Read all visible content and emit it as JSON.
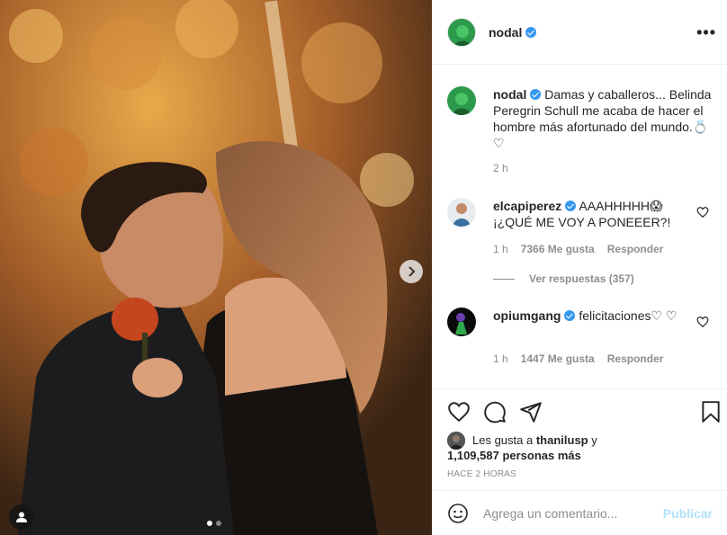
{
  "post": {
    "username": "nodal",
    "more_label": "•••"
  },
  "caption": {
    "username": "nodal",
    "text": "Damas y caballeros... Belinda Peregrin Schull me acaba de hacer el hombre más afortunado del mundo.💍♡",
    "age": "2 h"
  },
  "comments": [
    {
      "username": "elcapiperez",
      "text": "AAAHHHHH😱 ¡¿QUÉ ME VOY A PONEEER?!",
      "age": "1 h",
      "likes": "7366 Me gusta",
      "reply_label": "Responder",
      "replies_label": "Ver respuestas (357)"
    },
    {
      "username": "opiumgang",
      "text": "felicitaciones♡ ♡",
      "age": "1 h",
      "likes": "1447 Me gusta",
      "reply_label": "Responder"
    }
  ],
  "likes": {
    "prefix": "Les gusta a",
    "user": "thanilusp",
    "joiner": "y",
    "count": "1,109,587 personas más"
  },
  "timestamp": "HACE 2 HORAS",
  "add_comment": {
    "placeholder": "Agrega un comentario...",
    "submit_label": "Publicar"
  },
  "carousel": {
    "slide": 1,
    "total": 2
  },
  "icons": [
    "chevron-right-icon",
    "user-tag-icon",
    "heart-icon",
    "comment-icon",
    "share-icon",
    "bookmark-icon",
    "emoji-icon",
    "verified-icon",
    "more-icon"
  ],
  "colors": {
    "accent": "#3897f0",
    "publish_disabled": "#b2dffc",
    "muted": "#8e8e8e"
  }
}
